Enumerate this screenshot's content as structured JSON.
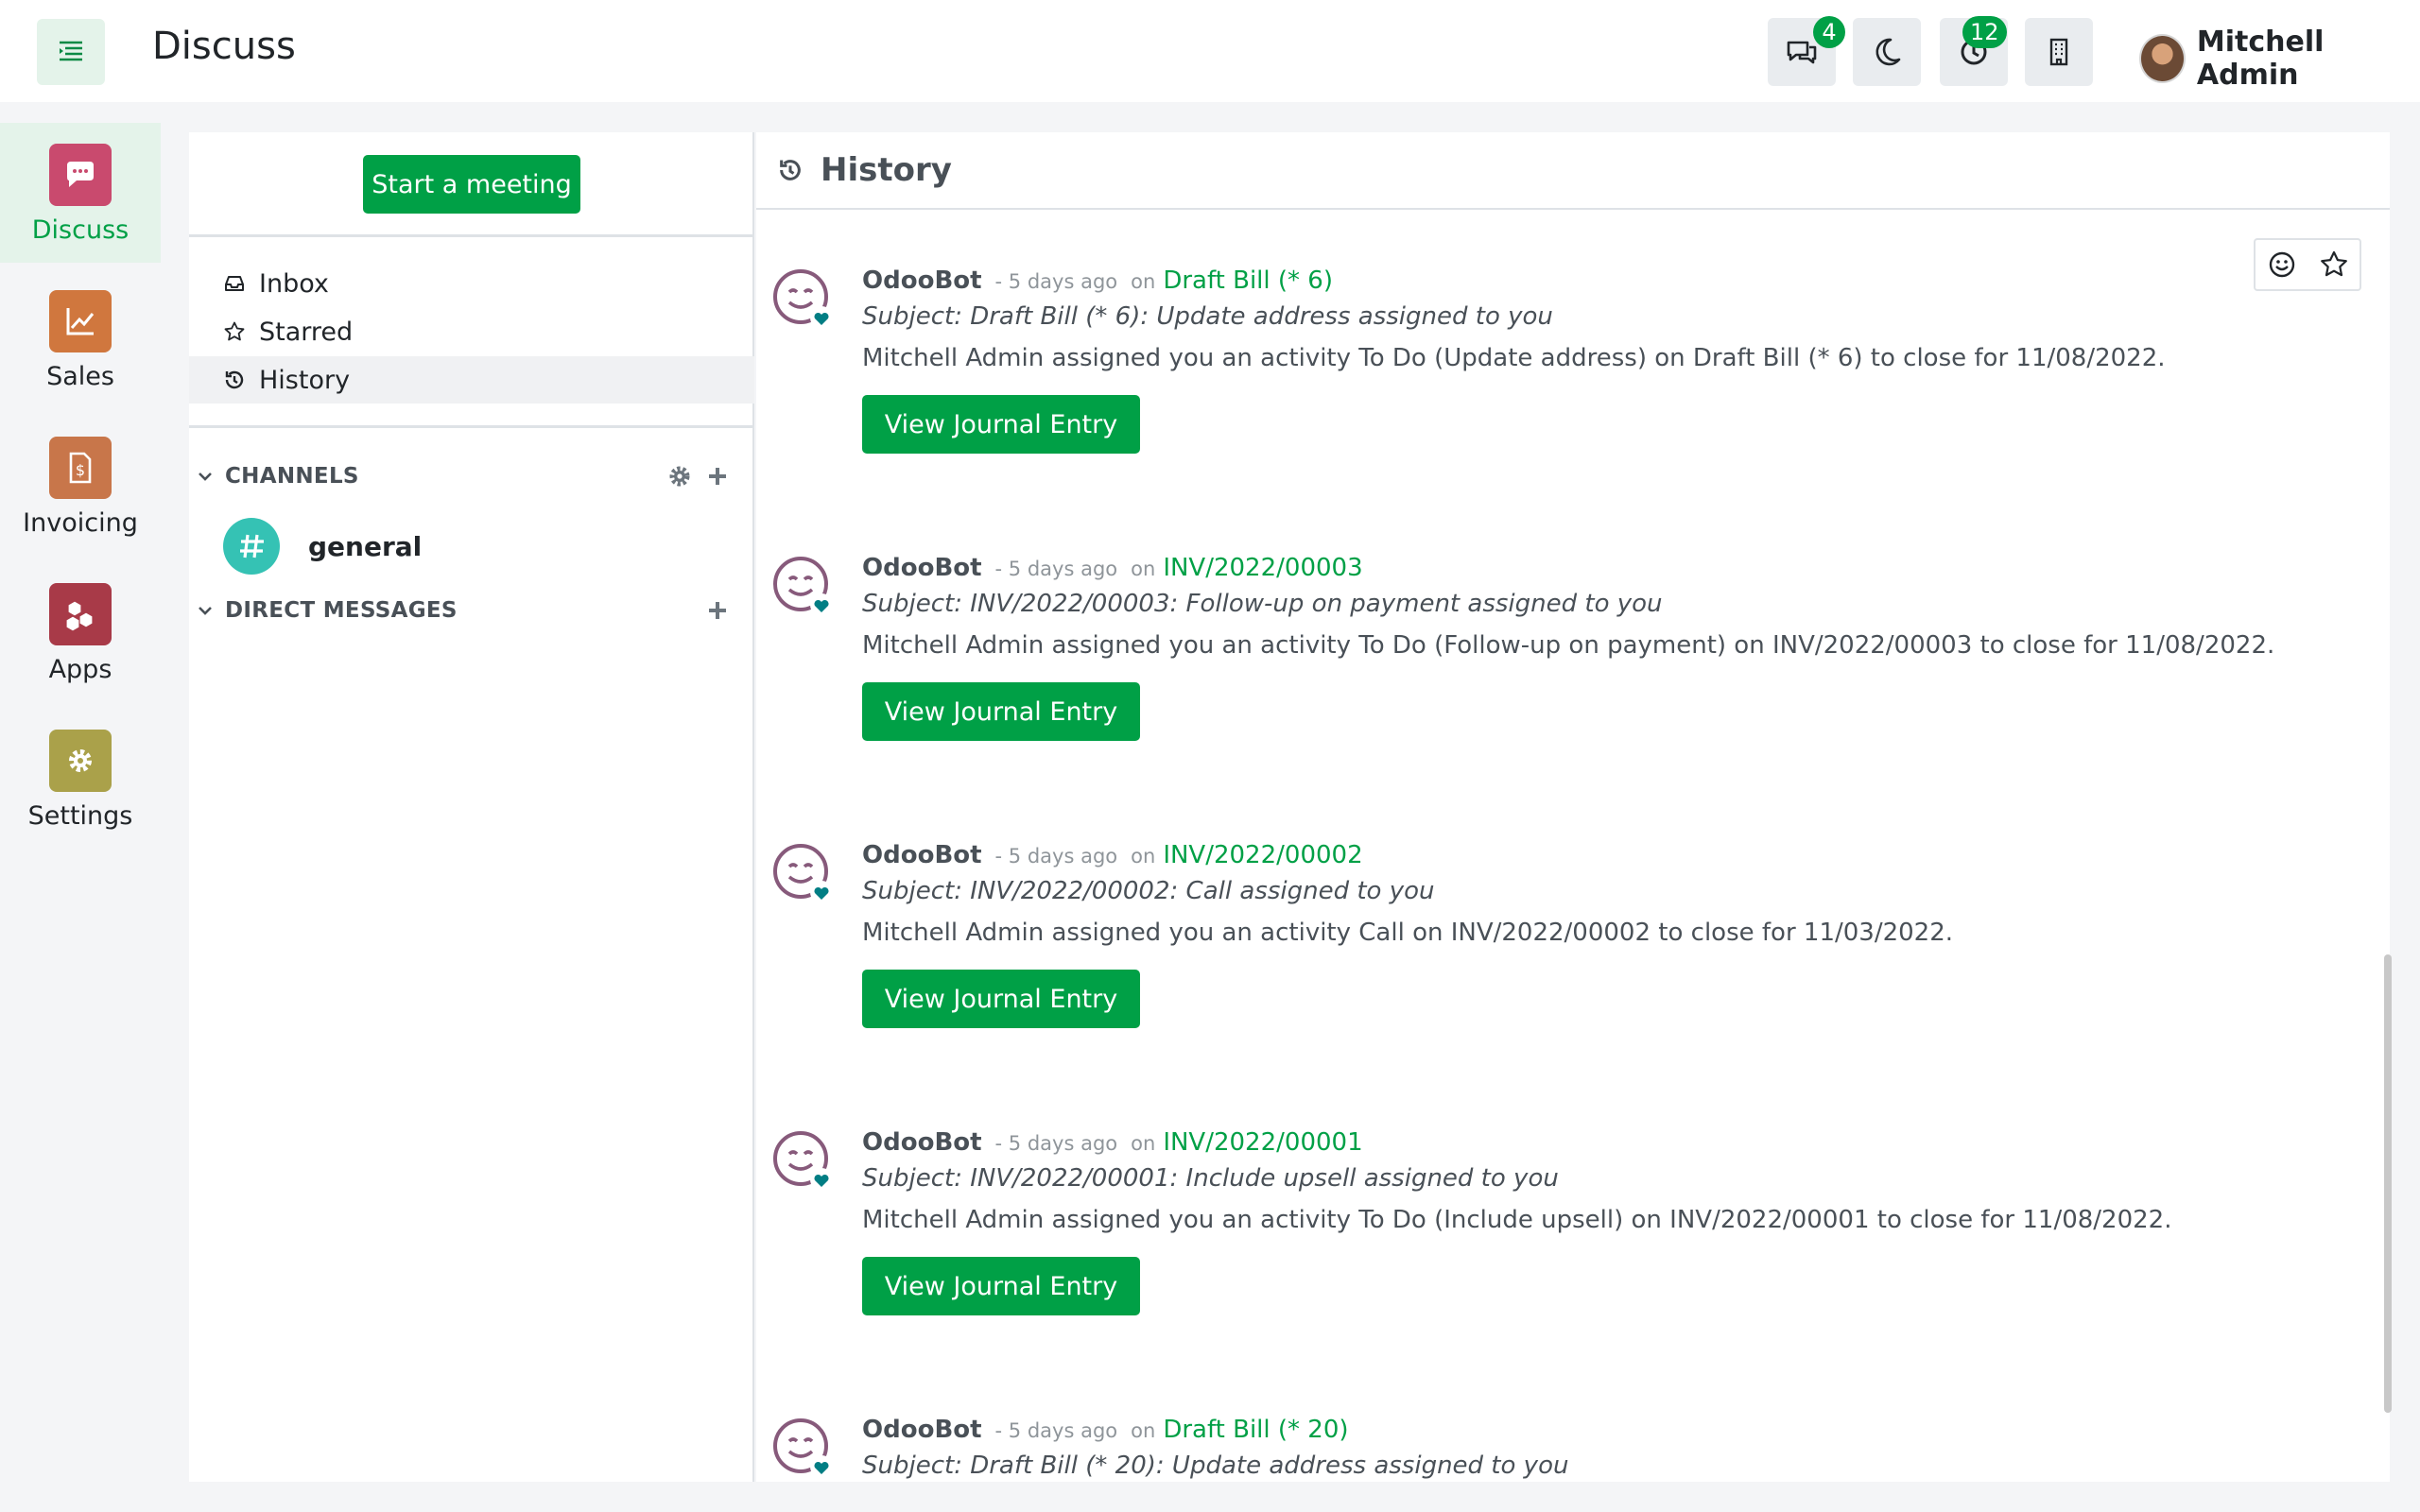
{
  "app": {
    "title": "Discuss"
  },
  "systray": {
    "messages_count": "4",
    "activities_count": "12"
  },
  "user": {
    "name": "Mitchell Admin"
  },
  "apps": [
    {
      "label": "Discuss",
      "color": "#c94a6e"
    },
    {
      "label": "Sales",
      "color": "#d0773e"
    },
    {
      "label": "Invoicing",
      "color": "#c8764a"
    },
    {
      "label": "Apps",
      "color": "#a83a48"
    },
    {
      "label": "Settings",
      "color": "#aaa14a"
    }
  ],
  "sidebar": {
    "start_meeting": "Start a meeting",
    "mailboxes": [
      {
        "label": "Inbox"
      },
      {
        "label": "Starred"
      },
      {
        "label": "History"
      }
    ],
    "channels_label": "CHANNELS",
    "direct_messages_label": "DIRECT MESSAGES",
    "channels": [
      {
        "name": "general"
      }
    ]
  },
  "thread": {
    "title": "History"
  },
  "messages": [
    {
      "author": "OdooBot",
      "date": "- 5 days ago",
      "on": "on",
      "record": "Draft Bill (* 6)",
      "subject": "Subject: Draft Bill (* 6): Update address assigned to you",
      "body": "Mitchell Admin assigned you an activity To Do (Update address) on Draft Bill (* 6) to close for 11/08/2022.",
      "button": "View Journal Entry"
    },
    {
      "author": "OdooBot",
      "date": "- 5 days ago",
      "on": "on",
      "record": "INV/2022/00003",
      "subject": "Subject: INV/2022/00003: Follow-up on payment assigned to you",
      "body": "Mitchell Admin assigned you an activity To Do (Follow-up on payment) on INV/2022/00003 to close for 11/08/2022.",
      "button": "View Journal Entry"
    },
    {
      "author": "OdooBot",
      "date": "- 5 days ago",
      "on": "on",
      "record": "INV/2022/00002",
      "subject": "Subject: INV/2022/00002: Call assigned to you",
      "body": "Mitchell Admin assigned you an activity Call on INV/2022/00002 to close for 11/03/2022.",
      "button": "View Journal Entry"
    },
    {
      "author": "OdooBot",
      "date": "- 5 days ago",
      "on": "on",
      "record": "INV/2022/00001",
      "subject": "Subject: INV/2022/00001: Include upsell assigned to you",
      "body": "Mitchell Admin assigned you an activity To Do (Include upsell) on INV/2022/00001 to close for 11/08/2022.",
      "button": "View Journal Entry"
    },
    {
      "author": "OdooBot",
      "date": "- 5 days ago",
      "on": "on",
      "record": "Draft Bill (* 20)",
      "subject": "Subject: Draft Bill (* 20): Update address assigned to you"
    }
  ]
}
